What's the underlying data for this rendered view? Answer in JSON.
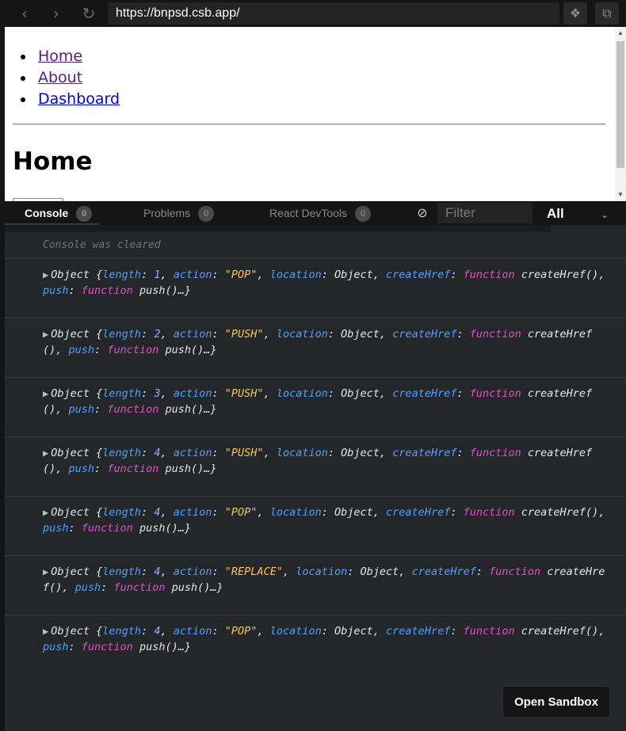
{
  "browser": {
    "back_icon": "chevron-left-icon",
    "forward_icon": "chevron-right-icon",
    "reload_icon": "reload-icon",
    "url": "https://bnpsd.csb.app/",
    "extensions_icon": "codesandbox-icon",
    "open_new_window_icon": "external-link-icon"
  },
  "preview": {
    "nav_links": [
      {
        "label": "Home",
        "visited": true
      },
      {
        "label": "About",
        "visited": true
      },
      {
        "label": "Dashboard",
        "visited": false
      }
    ],
    "heading": "Home"
  },
  "devtools": {
    "tabs": [
      {
        "label": "Console",
        "count": "0",
        "active": true
      },
      {
        "label": "Problems",
        "count": "0",
        "active": false
      },
      {
        "label": "React DevTools",
        "count": "0",
        "active": false
      }
    ],
    "filter_placeholder": "Filter",
    "level": "All",
    "cleared_message": "Console was cleared",
    "entries": [
      {
        "length": "1",
        "action": "\"POP\""
      },
      {
        "length": "2",
        "action": "\"PUSH\""
      },
      {
        "length": "3",
        "action": "\"PUSH\""
      },
      {
        "length": "4",
        "action": "\"PUSH\""
      },
      {
        "length": "4",
        "action": "\"POP\""
      },
      {
        "length": "4",
        "action": "\"REPLACE\""
      },
      {
        "length": "4",
        "action": "\"POP\""
      }
    ],
    "entry_text": {
      "object": "Object",
      "open_brace": "{",
      "length_key": "length",
      "action_key": "action",
      "location_key": "location",
      "location_value": "Object",
      "createhref_key": "createHref",
      "function_keyword": "function",
      "createhref_value": "createHref()",
      "push_key": "push",
      "push_value": "push()",
      "close": "…}"
    },
    "open_sandbox_label": "Open Sandbox"
  }
}
